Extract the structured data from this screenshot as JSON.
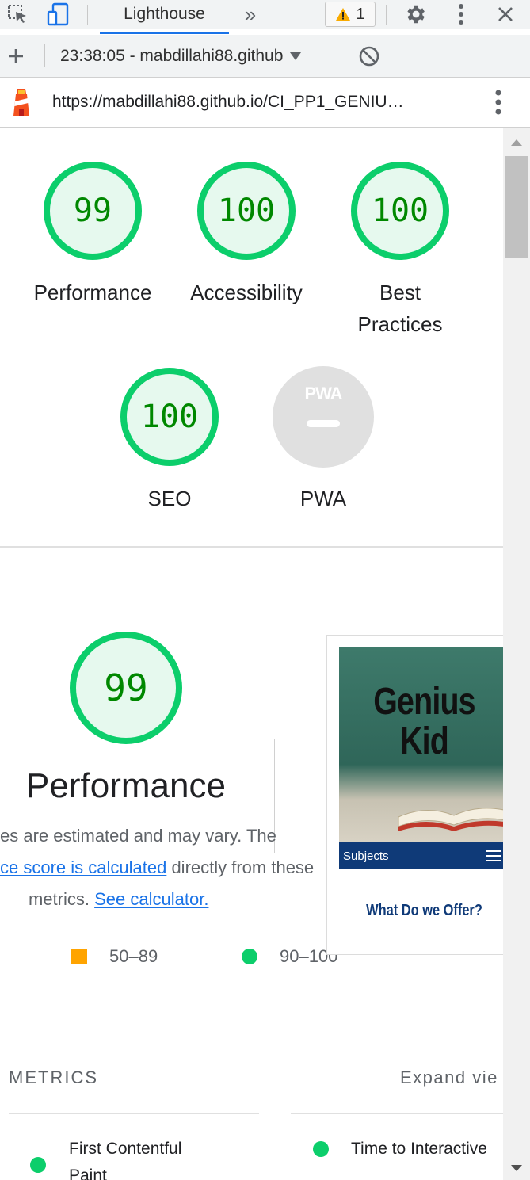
{
  "devtools": {
    "tab_label": "Lighthouse",
    "more_tabs_glyph": "»",
    "warning_count": "1",
    "report_select_label": "23:38:05 - mabdillahi88.github",
    "url": "https://mabdillahi88.github.io/CI_PP1_GENIU…"
  },
  "scores": [
    {
      "value": "99",
      "label": "Performance"
    },
    {
      "value": "100",
      "label": "Accessibility"
    },
    {
      "value": "100",
      "label_line1": "Best",
      "label_line2": "Practices"
    },
    {
      "value": "100",
      "label": "SEO"
    },
    {
      "value": "PWA",
      "label": "PWA"
    }
  ],
  "performance": {
    "score": "99",
    "title": "Performance",
    "desc_line1": "es are estimated and may vary. The",
    "desc_line2_link": "ce score is calculated",
    "desc_line2_rest": " directly from these",
    "desc_line3_text": "metrics.",
    "desc_line3_link": "See calculator.",
    "legend": [
      {
        "range": "50–89",
        "color": "#ffa400"
      },
      {
        "range": "90–100",
        "color": "#0cce6b"
      }
    ]
  },
  "screenshot": {
    "site_title_line1": "Genius",
    "site_title_line2": "Kid",
    "nav_label": "Subjects",
    "offer_heading": "What Do we Offer?"
  },
  "metrics": {
    "header": "METRICS",
    "expand_label": "Expand vie",
    "items": [
      {
        "name_line1": "First Contentful",
        "name_line2": "Paint"
      },
      {
        "name_line1": "Time to Interactive"
      }
    ]
  },
  "colors": {
    "pass": "#0cce6b",
    "pass_fill": "#e6f9ee",
    "pass_text": "#008800",
    "average": "#ffa400",
    "link": "#1a73e8",
    "pwa_gray": "#e0e0e0"
  }
}
